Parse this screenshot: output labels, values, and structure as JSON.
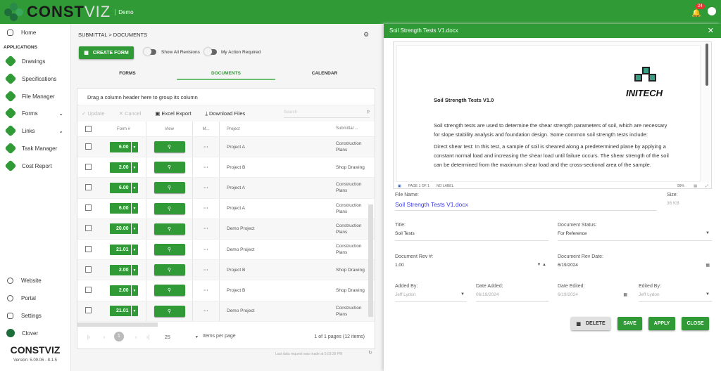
{
  "header": {
    "brand": "CONST",
    "brand2": "VIZ",
    "env": "Demo",
    "notifications": "24"
  },
  "sidebar": {
    "section": "APPLICATIONS",
    "items": [
      {
        "label": "Home"
      },
      {
        "label": "Drawings"
      },
      {
        "label": "Specifications"
      },
      {
        "label": "File Manager"
      },
      {
        "label": "Forms"
      },
      {
        "label": "Links"
      },
      {
        "label": "Task Manager"
      },
      {
        "label": "Cost Report"
      }
    ],
    "bottom": [
      {
        "label": "Website"
      },
      {
        "label": "Portal"
      },
      {
        "label": "Settings"
      },
      {
        "label": "Clover"
      }
    ],
    "footer_brand": "CONSTVIZ",
    "version": "Version: 5.09.06 - 8.1.5"
  },
  "main": {
    "breadcrumb": "SUBMITTAL > DOCUMENTS",
    "create": "CREATE FORM",
    "toggle1": "Show All Revisions",
    "toggle2": "My Action Required",
    "tabs": [
      "FORMS",
      "DOCUMENTS",
      "CALENDAR"
    ],
    "grid": {
      "group_hint": "Drag a column header here to group its column",
      "toolbar": {
        "update": "Update",
        "cancel": "Cancel",
        "excel": "Excel Export",
        "download": "Download Files",
        "search_placeholder": "Search"
      },
      "columns": [
        "Form #",
        "View",
        "M...",
        "Project",
        "Submittal ..."
      ],
      "rows": [
        {
          "form": "6.00",
          "project": "Project A",
          "type": "Construction Plans"
        },
        {
          "form": "2.00",
          "project": "Project B",
          "type": "Shop Drawing"
        },
        {
          "form": "6.00",
          "project": "Project A",
          "type": "Construction Plans"
        },
        {
          "form": "6.00",
          "project": "Project A",
          "type": "Construction Plans"
        },
        {
          "form": "20.00",
          "project": "Demo Project",
          "type": "Construction Plans"
        },
        {
          "form": "21.01",
          "project": "Demo Project",
          "type": "Construction Plans"
        },
        {
          "form": "2.00",
          "project": "Project B",
          "type": "Shop Drawing"
        },
        {
          "form": "2.00",
          "project": "Project B",
          "type": "Shop Drawing"
        },
        {
          "form": "21.01",
          "project": "Demo Project",
          "type": "Construction Plans"
        }
      ],
      "pager": {
        "page": "1",
        "size": "25",
        "items_label": "Items per page",
        "summary": "1 of 1 pages (12 items)"
      }
    },
    "last_request": "Last data request was made at 5:03:39 PM"
  },
  "panel": {
    "title": "Soil Strength Tests V1.docx",
    "doc": {
      "logo": "INITECH",
      "heading": "Soil Strength Tests V1.0",
      "p1": "Soil strength tests are used to determine the shear strength parameters of soil, which are necessary for slope stability analysis and foundation design. Some common soil strength tests include:",
      "p2": "Direct shear test: In this test, a sample of soil is sheared along a predetermined plane by applying a constant normal load and increasing the shear load until failure occurs. The shear strength of the soil can be determined from the maximum shear load and the cross-sectional area of the sample.",
      "page": "PAGE 1 OF 1",
      "label": "NO LABEL",
      "zoom": "99%"
    },
    "fields": {
      "file_name_label": "File Name:",
      "file_name": "Soil Strength Tests V1.docx",
      "size_label": "Size:",
      "size": "36 KB",
      "title_label": "Title:",
      "title": "Soil Tests",
      "status_label": "Document Status:",
      "status": "For Reference",
      "rev_label": "Document Rev #:",
      "rev": "1.00",
      "rev_date_label": "Document Rev Date:",
      "rev_date": "6/19/2024",
      "added_by_label": "Added By:",
      "added_by": "Jeff Lydon",
      "date_added_label": "Date Added:",
      "date_added": "06/19/2024",
      "date_edited_label": "Date Edited:",
      "date_edited": "6/19/2024",
      "edited_by_label": "Edited By:",
      "edited_by": "Jeff Lydon"
    },
    "buttons": {
      "delete": "DELETE",
      "save": "SAVE",
      "apply": "APPLY",
      "close": "CLOSE"
    }
  }
}
